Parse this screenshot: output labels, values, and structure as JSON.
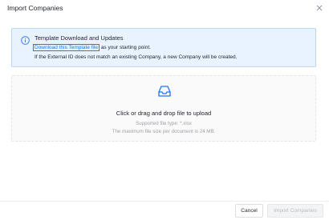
{
  "dialog": {
    "title": "Import Companies"
  },
  "info": {
    "title": "Template Download and Updates",
    "link_text": "Download this Template file",
    "line1_suffix": " as your starting point.",
    "line2": "If the External ID does not match an existing Company, a new Company will be created.",
    "icon": "info-icon"
  },
  "upload": {
    "icon": "inbox-icon",
    "main": "Click or drag and drop file to upload",
    "supported": "Supported file type: *.xlsx",
    "max_size": "The maximum file size per document is 24 MB."
  },
  "footer": {
    "cancel_label": "Cancel",
    "import_label": "Import Companies"
  },
  "colors": {
    "accent": "#1f73ff",
    "highlight_border": "#e0402e",
    "info_bg": "#e9f3ff"
  }
}
